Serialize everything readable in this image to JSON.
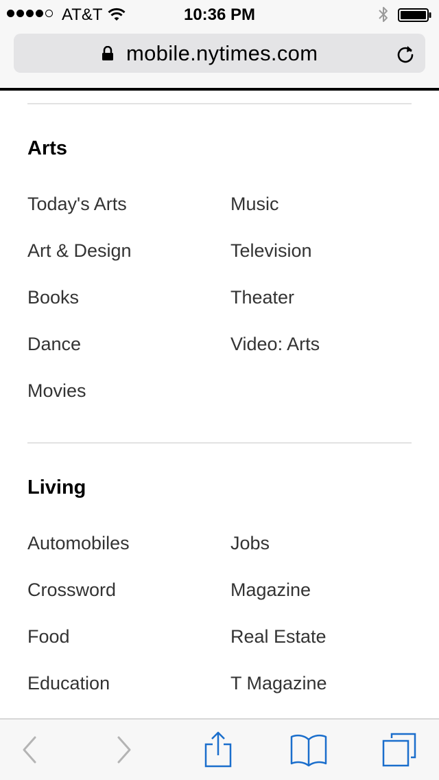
{
  "status_bar": {
    "carrier": "AT&T",
    "time": "10:36 PM",
    "signal_bars_filled": 4,
    "signal_bars_total": 5
  },
  "browser": {
    "url": "mobile.nytimes.com"
  },
  "sections": [
    {
      "title": "Arts",
      "links_col1": [
        "Today's Arts",
        "Art & Design",
        "Books",
        "Dance",
        "Movies"
      ],
      "links_col2": [
        "Music",
        "Television",
        "Theater",
        "Video: Arts"
      ]
    },
    {
      "title": "Living",
      "links_col1": [
        "Automobiles",
        "Crossword",
        "Food",
        "Education"
      ],
      "links_col2": [
        "Jobs",
        "Magazine",
        "Real Estate",
        "T Magazine"
      ]
    }
  ],
  "toolbar": {
    "icons": [
      "back-icon",
      "forward-icon",
      "share-icon",
      "bookmarks-icon",
      "tabs-icon"
    ]
  },
  "colors": {
    "accent": "#1a6ecc",
    "disabled": "#b4b4b4",
    "link_text": "#333333"
  }
}
